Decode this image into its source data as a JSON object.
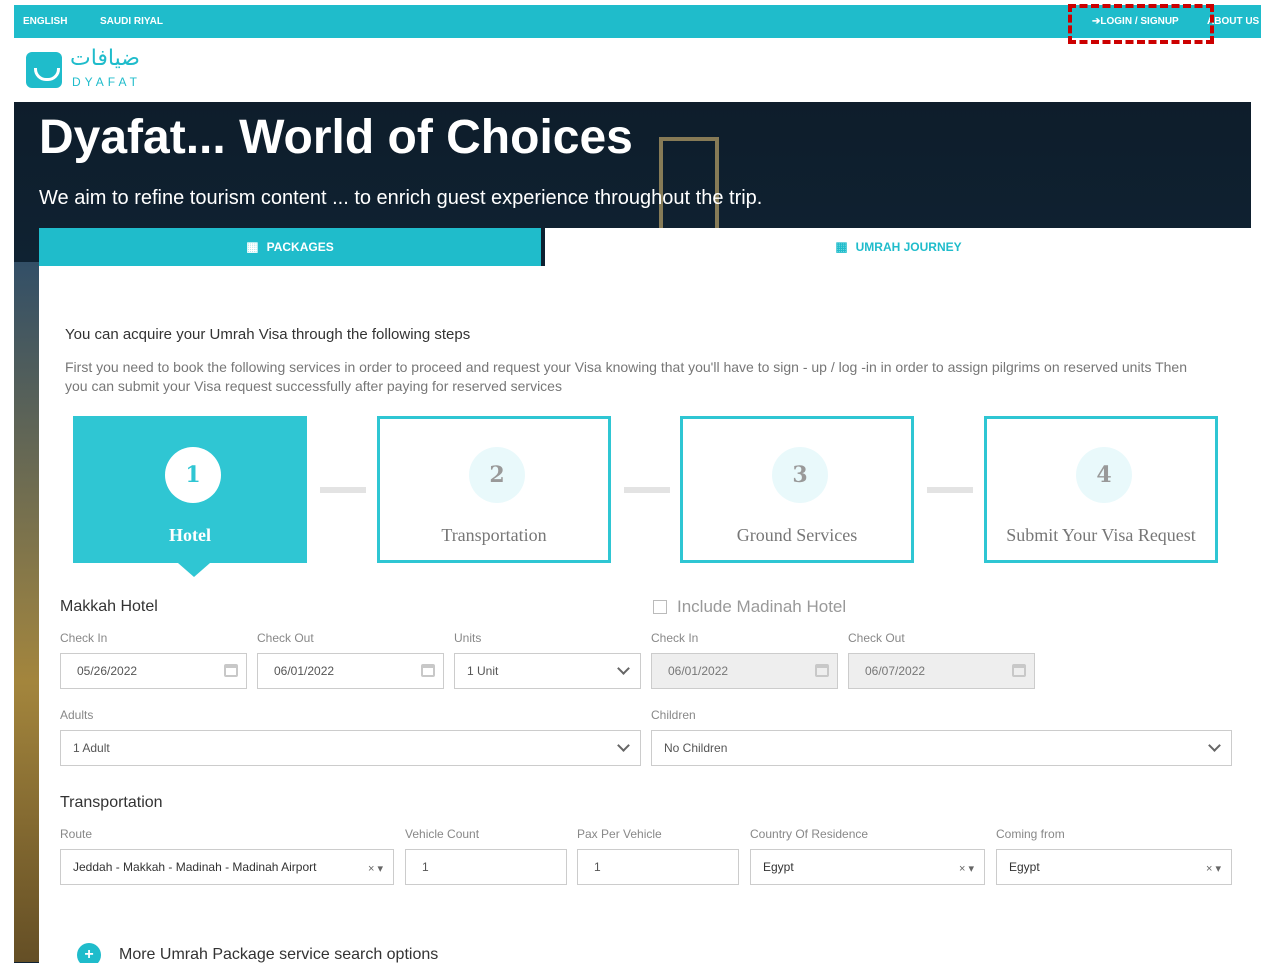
{
  "topbar": {
    "language": "ENGLISH",
    "currency": "SAUDI RIYAL",
    "login": "➔LOGIN / SIGNUP",
    "about": "ABOUT US"
  },
  "logo": {
    "arabic": "ضيافات",
    "english": "DYAFAT"
  },
  "hero": {
    "title": "Dyafat... World of Choices",
    "subtitle": "We aim to refine tourism content ... to enrich guest experience throughout the trip."
  },
  "tabs": [
    {
      "label": "PACKAGES",
      "icon": "bed-icon"
    },
    {
      "label": "UMRAH JOURNEY",
      "icon": "bed-icon"
    }
  ],
  "intro": {
    "title": "You can acquire your Umrah Visa through the following steps",
    "text": "First you need to book the following services in order to proceed and request your Visa knowing that you'll have to sign - up / log -in in order to assign pilgrims on reserved units Then you can submit your Visa request successfully after paying for reserved services"
  },
  "steps": [
    {
      "number": "1",
      "label": "Hotel"
    },
    {
      "number": "2",
      "label": "Transportation"
    },
    {
      "number": "3",
      "label": "Ground Services"
    },
    {
      "number": "4",
      "label": "Submit Your Visa Request"
    }
  ],
  "makkah": {
    "title": "Makkah Hotel",
    "checkin_label": "Check In",
    "checkin_value": "05/26/2022",
    "checkout_label": "Check Out",
    "checkout_value": "06/01/2022",
    "units_label": "Units",
    "units_value": "1 Unit",
    "adults_label": "Adults",
    "adults_value": "1 Adult"
  },
  "madinah": {
    "title": "Include Madinah Hotel",
    "checkin_label": "Check In",
    "checkin_value": "06/01/2022",
    "checkout_label": "Check Out",
    "checkout_value": "06/07/2022",
    "children_label": "Children",
    "children_value": "No Children"
  },
  "transport": {
    "title": "Transportation",
    "route_label": "Route",
    "route_value": "Jeddah - Makkah - Madinah - Madinah Airport",
    "vehicle_count_label": "Vehicle Count",
    "vehicle_count_value": "1",
    "pax_label": "Pax Per Vehicle",
    "pax_value": "1",
    "country_label": "Country Of Residence",
    "country_value": "Egypt",
    "coming_label": "Coming from",
    "coming_value": "Egypt"
  },
  "more_options": "More Umrah Package service search options",
  "colors": {
    "accent": "#1fbccb",
    "highlight": "#cc0000"
  }
}
